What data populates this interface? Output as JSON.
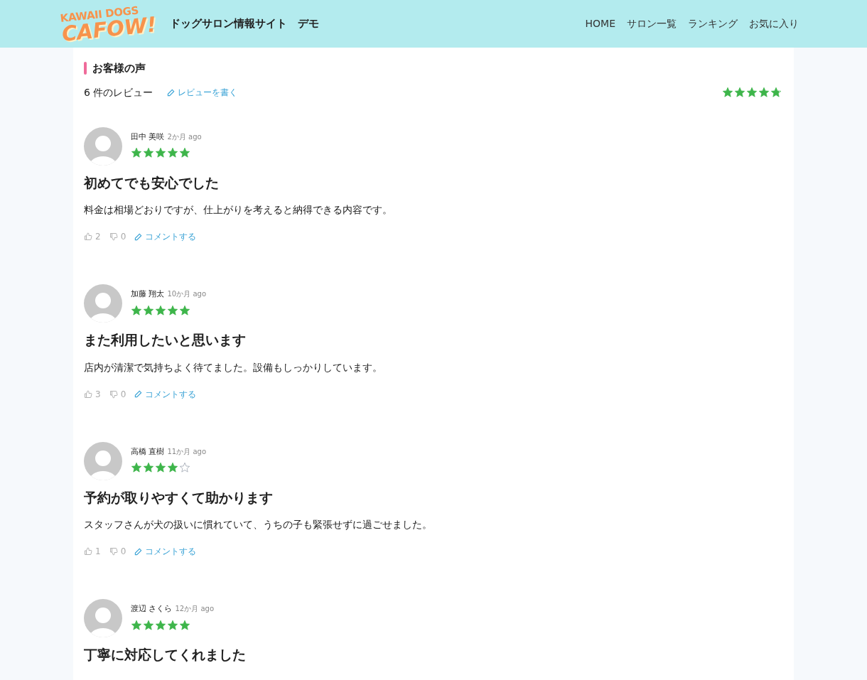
{
  "header": {
    "logo_top": "KAWAII DOGS",
    "logo_bottom": "CAFOW!",
    "site_title": "ドッグサロン情報サイト　デモ",
    "nav": [
      "HOME",
      "サロン一覧",
      "ランキング",
      "お気に入り"
    ]
  },
  "section": {
    "title": "お客様の声",
    "review_count": "6 件のレビュー",
    "write_review": "レビューを書く",
    "stars": 4.8
  },
  "reviews": [
    {
      "name": "田中 美咲",
      "time": "2か月 ago",
      "stars": 5,
      "title": "初めてでも安心でした",
      "body": "料金は相場どおりですが、仕上がりを考えると納得できる内容です。",
      "likes": "2",
      "dislikes": "0",
      "comment": "コメントする"
    },
    {
      "name": "加藤 翔太",
      "time": "10か月 ago",
      "stars": 5,
      "title": "また利用したいと思います",
      "body": "店内が清潔で気持ちよく待てました。設備もしっかりしています。",
      "likes": "3",
      "dislikes": "0",
      "comment": "コメントする"
    },
    {
      "name": "高橋 直樹",
      "time": "11か月 ago",
      "stars": 4,
      "title": "予約が取りやすくて助かります",
      "body": "スタッフさんが犬の扱いに慣れていて、うちの子も緊張せずに過ごせました。",
      "likes": "1",
      "dislikes": "0",
      "comment": "コメントする"
    },
    {
      "name": "渡辺 さくら",
      "time": "12か月 ago",
      "stars": 5,
      "title": "丁寧に対応してくれました"
    }
  ]
}
